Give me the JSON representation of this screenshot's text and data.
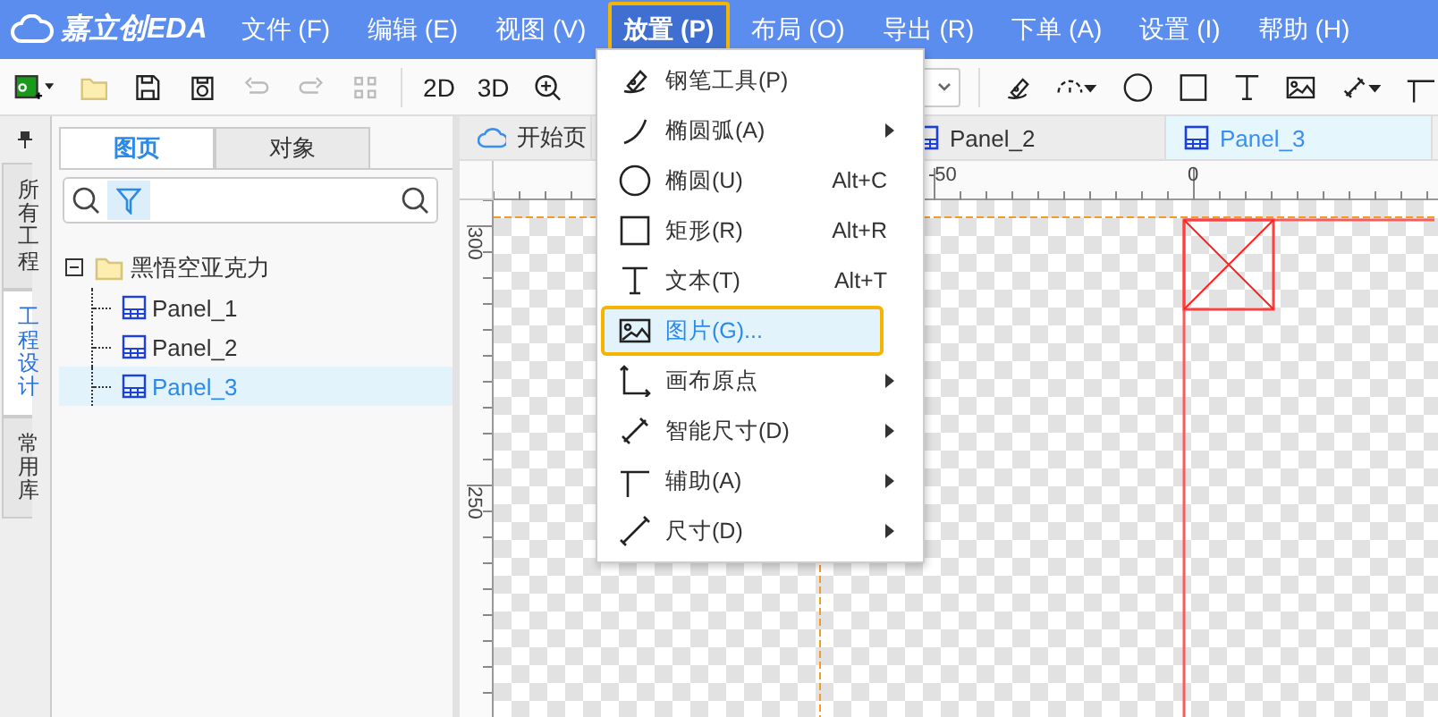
{
  "app": {
    "logo": "嘉立创EDA"
  },
  "menu_bar": [
    {
      "label": "文件 (F)",
      "selected": false
    },
    {
      "label": "编辑 (E)",
      "selected": false
    },
    {
      "label": "视图 (V)",
      "selected": false
    },
    {
      "label": "放置 (P)",
      "selected": true
    },
    {
      "label": "布局 (O)",
      "selected": false
    },
    {
      "label": "导出 (R)",
      "selected": false
    },
    {
      "label": "下单 (A)",
      "selected": false
    },
    {
      "label": "设置 (I)",
      "selected": false
    },
    {
      "label": "帮助 (H)",
      "selected": false
    }
  ],
  "toolbar": {
    "view_buttons": [
      "2D",
      "3D"
    ]
  },
  "side_tabs": [
    {
      "label": "所有工程",
      "selected": false
    },
    {
      "label": "工程设计",
      "selected": true
    },
    {
      "label": "常用库",
      "selected": false
    }
  ],
  "panel": {
    "tabs": [
      {
        "label": "图页",
        "selected": true
      },
      {
        "label": "对象",
        "selected": false
      }
    ],
    "filter_on": true,
    "tree": {
      "label": "黑悟空亚克力",
      "expanded": true,
      "children": [
        {
          "label": "Panel_1",
          "selected": false
        },
        {
          "label": "Panel_2",
          "selected": false
        },
        {
          "label": "Panel_3",
          "selected": true
        }
      ]
    }
  },
  "document_tabs": [
    {
      "label": "开始页",
      "kind": "home",
      "selected": false
    },
    {
      "label": "Panel_2",
      "kind": "panel",
      "selected": false
    },
    {
      "label": "Panel_3",
      "kind": "panel",
      "selected": true
    }
  ],
  "rulers": {
    "horizontal": [
      "-50",
      "0"
    ],
    "vertical": [
      "300",
      "250"
    ]
  },
  "place_menu": [
    {
      "label": "钢笔工具(P)",
      "submenu": false,
      "selected": false
    },
    {
      "label": "椭圆弧(A)",
      "submenu": true,
      "selected": false
    },
    {
      "label": "椭圆(U)",
      "shortcut": "Alt+C",
      "submenu": false,
      "selected": false
    },
    {
      "label": "矩形(R)",
      "shortcut": "Alt+R",
      "submenu": false,
      "selected": false
    },
    {
      "label": "文本(T)",
      "shortcut": "Alt+T",
      "submenu": false,
      "selected": false
    },
    {
      "label": "图片(G)...",
      "submenu": false,
      "selected": true
    },
    {
      "label": "画布原点",
      "submenu": true,
      "selected": false
    },
    {
      "label": "智能尺寸(D)",
      "submenu": true,
      "selected": false
    },
    {
      "label": "辅助(A)",
      "submenu": true,
      "selected": false
    },
    {
      "label": "尺寸(D)",
      "submenu": true,
      "selected": false
    }
  ]
}
